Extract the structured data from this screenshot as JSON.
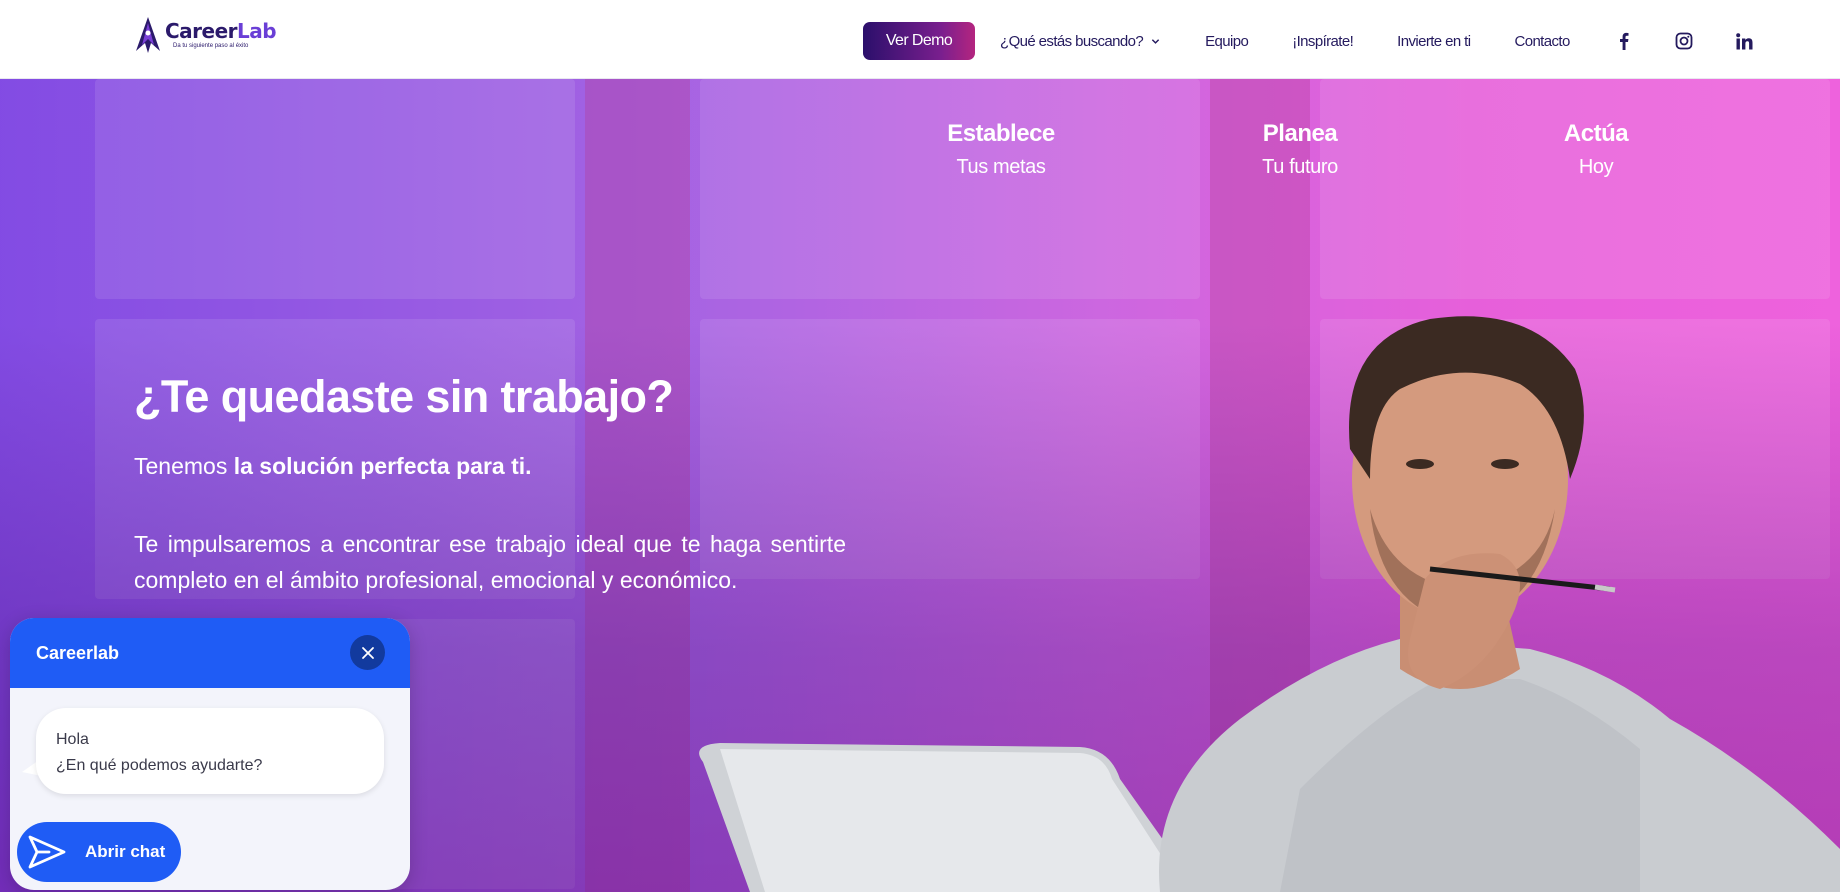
{
  "brand": {
    "name_main": "Career",
    "name_accent": "Lab",
    "tagline": "Da tu siguiente paso al éxito",
    "primary_color": "#2b1a6b",
    "accent_color": "#6a3fd6"
  },
  "nav": {
    "demo_label": "Ver Demo",
    "items": [
      {
        "label": "¿Qué estás buscando?",
        "has_dropdown": true
      },
      {
        "label": "Equipo"
      },
      {
        "label": "¡Inspírate!"
      },
      {
        "label": "Invierte en ti"
      },
      {
        "label": "Contacto"
      }
    ],
    "social": [
      {
        "icon": "facebook-icon"
      },
      {
        "icon": "instagram-icon"
      },
      {
        "icon": "linkedin-icon"
      }
    ]
  },
  "pillars": [
    {
      "title": "Establece",
      "subtitle": "Tus metas"
    },
    {
      "title": "Planea",
      "subtitle": "Tu futuro"
    },
    {
      "title": "Actúa",
      "subtitle": "Hoy"
    }
  ],
  "hero": {
    "headline": "¿Te quedaste sin trabajo?",
    "lead_prefix": "Tenemos ",
    "lead_bold": "la solución perfecta para ti.",
    "paragraph": "Te impulsaremos a encontrar ese trabajo ideal que te haga sentirte completo en el ámbito profesional, emocional y económico."
  },
  "chat": {
    "title": "Careerlab",
    "greeting_line1": "Hola",
    "greeting_line2": "¿En qué podemos ayudarte?",
    "open_label": "Abrir chat",
    "color": "#1f5cf5"
  }
}
